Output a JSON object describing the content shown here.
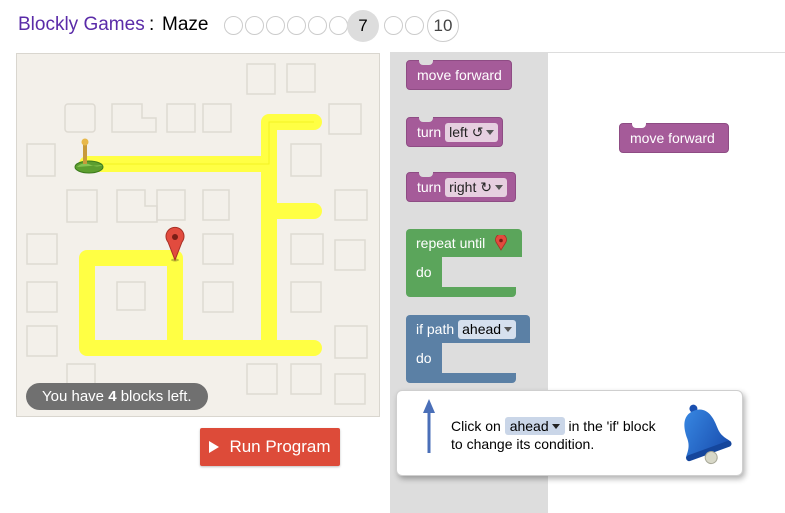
{
  "header": {
    "brand": "Blockly Games",
    "separator": ":",
    "game": "Maze",
    "current_level": "7",
    "last_level": "10"
  },
  "maze": {
    "blocks_left_prefix": "You have ",
    "blocks_left_count": "4",
    "blocks_left_suffix": " blocks left.",
    "colors": {
      "path": "#ffff44",
      "background": "#f3f0ea",
      "marker": "#e24b3e"
    }
  },
  "run_button": {
    "label": "Run Program",
    "color": "#dd4b39"
  },
  "toolbox": {
    "move_forward": "move forward",
    "turn_label": "turn",
    "turn_left_option": "left ↺",
    "turn_right_option": "right ↻",
    "repeat_label": "repeat until",
    "repeat_icon": "marker-icon",
    "do_label": "do",
    "if_label": "if path",
    "if_option": "ahead",
    "if_do_label": "do",
    "colors": {
      "movement": "#a55b99",
      "loop": "#5ba55b",
      "logic": "#5b80a5"
    }
  },
  "workspace": {
    "move_forward": "move forward"
  },
  "hint": {
    "line_before": "Click on ",
    "dropdown": "ahead",
    "line_after": " in the 'if' block to change its condition.",
    "icon": "bell-icon",
    "arrow_icon": "up-arrow-icon"
  }
}
